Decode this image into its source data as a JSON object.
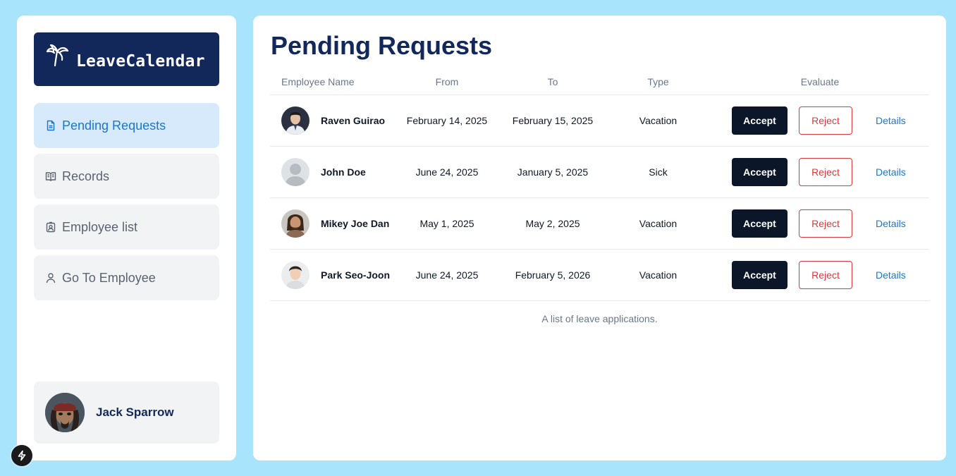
{
  "brand": {
    "name": "LeaveCalendar",
    "icon": "palm-tree-icon"
  },
  "nav": [
    {
      "label": "Pending Requests",
      "icon": "file-text-icon",
      "active": true
    },
    {
      "label": "Records",
      "icon": "book-open-icon",
      "active": false
    },
    {
      "label": "Employee list",
      "icon": "id-badge-icon",
      "active": false
    },
    {
      "label": "Go To Employee",
      "icon": "user-icon",
      "active": false
    }
  ],
  "user": {
    "name": "Jack Sparrow"
  },
  "main": {
    "title": "Pending Requests",
    "columns": {
      "name": "Employee Name",
      "from": "From",
      "to": "To",
      "type": "Type",
      "evaluate": "Evaluate"
    },
    "rows": [
      {
        "name": "Raven Guirao",
        "from": "February 14, 2025",
        "to": "February 15, 2025",
        "type": "Vacation"
      },
      {
        "name": "John Doe",
        "from": "June 24, 2025",
        "to": "January 5, 2025",
        "type": "Sick"
      },
      {
        "name": "Mikey Joe Dan",
        "from": "May 1, 2025",
        "to": "May 2, 2025",
        "type": "Vacation"
      },
      {
        "name": "Park Seo-Joon",
        "from": "June 24, 2025",
        "to": "February 5, 2026",
        "type": "Vacation"
      }
    ],
    "actions": {
      "accept": "Accept",
      "reject": "Reject",
      "details": "Details"
    },
    "caption": "A list of leave applications."
  },
  "colors": {
    "background": "#a8e4fc",
    "brand": "#13285a",
    "active_nav": "#d7eafc",
    "accent_blue": "#1877d4",
    "accept": "#0b1628",
    "reject": "#d83a3a"
  }
}
